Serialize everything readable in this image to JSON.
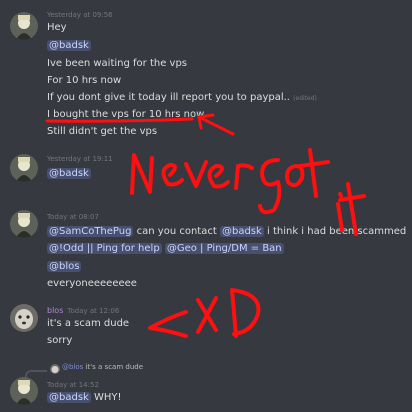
{
  "messages": [
    {
      "header": "Yesterday at 09:56",
      "lines": [
        "Hey",
        "@badsk",
        "Ive been waiting for the vps",
        "For 10 hrs now",
        "If you dont give it today ill report you to paypal..",
        "I bought the vps for 10 hrs now.",
        "Still didn't get the vps"
      ],
      "edited": "(edited)"
    },
    {
      "header": "Yesterday at 19:11",
      "lines": [
        "@badsk"
      ]
    },
    {
      "header": "Today at 08:07",
      "lines": [
        "@SamCoThePug",
        "can you contact",
        "@badsk",
        "i think i had been scammed",
        "@!Odd || Ping for help",
        "@Geo | Ping/DM = Ban",
        "@blos",
        "everyoneeeeeeee"
      ]
    },
    {
      "author": "blos",
      "header": "Today at 12:06",
      "lines": [
        "it's a scam dude",
        "sorry"
      ]
    },
    {
      "reply": {
        "mention": "@blos",
        "text": "it's a scam dude"
      },
      "header": "Today at 14:52",
      "lines": [
        "@badsk",
        "WHY!"
      ]
    }
  ],
  "annotations": {
    "text": "Never got it",
    "reaction": "xD"
  },
  "colors": {
    "background": "#36393f",
    "text": "#dcddde",
    "muted": "#72767d",
    "mention_bg": "#4f5a8a",
    "ink": "#ff0f0f",
    "username": "#b288d9"
  }
}
